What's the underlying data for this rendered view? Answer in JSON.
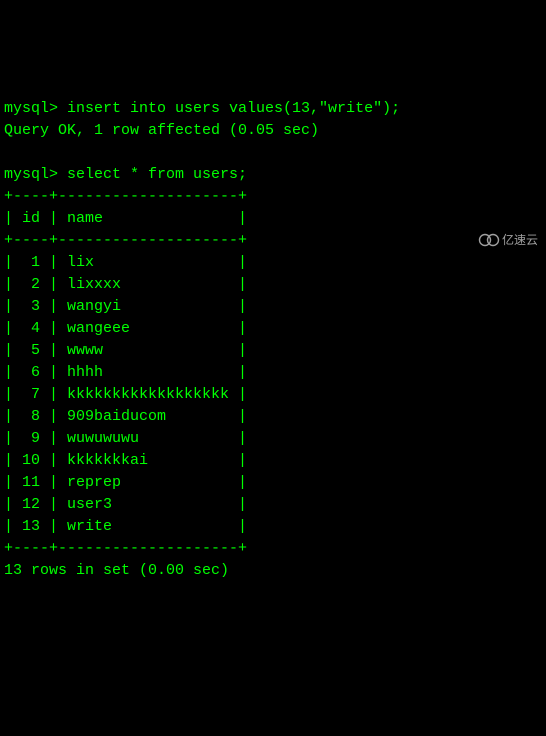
{
  "line1_prompt": "mysql> ",
  "line1_cmd": "insert into users values(13,\"write\");",
  "line2": "Query OK, 1 row affected (0.05 sec)",
  "blank": "",
  "line3_prompt": "mysql> ",
  "line3_cmd": "select * from users;",
  "sep": "+----+--------------------+",
  "header": "| id | name               |",
  "rows": [
    "|  1 | lix                |",
    "|  2 | lixxxx             |",
    "|  3 | wangyi             |",
    "|  4 | wangeee            |",
    "|  5 | wwww               |",
    "|  6 | hhhh               |",
    "|  7 | kkkkkkkkkkkkkkkkkk |",
    "|  8 | 909baiducom        |",
    "|  9 | wuwuwuwu           |",
    "| 10 | kkkkkkkai          |",
    "| 11 | reprep             |",
    "| 12 | user3              |",
    "| 13 | write              |"
  ],
  "footer": "13 rows in set (0.00 sec)",
  "watermark": "亿速云"
}
